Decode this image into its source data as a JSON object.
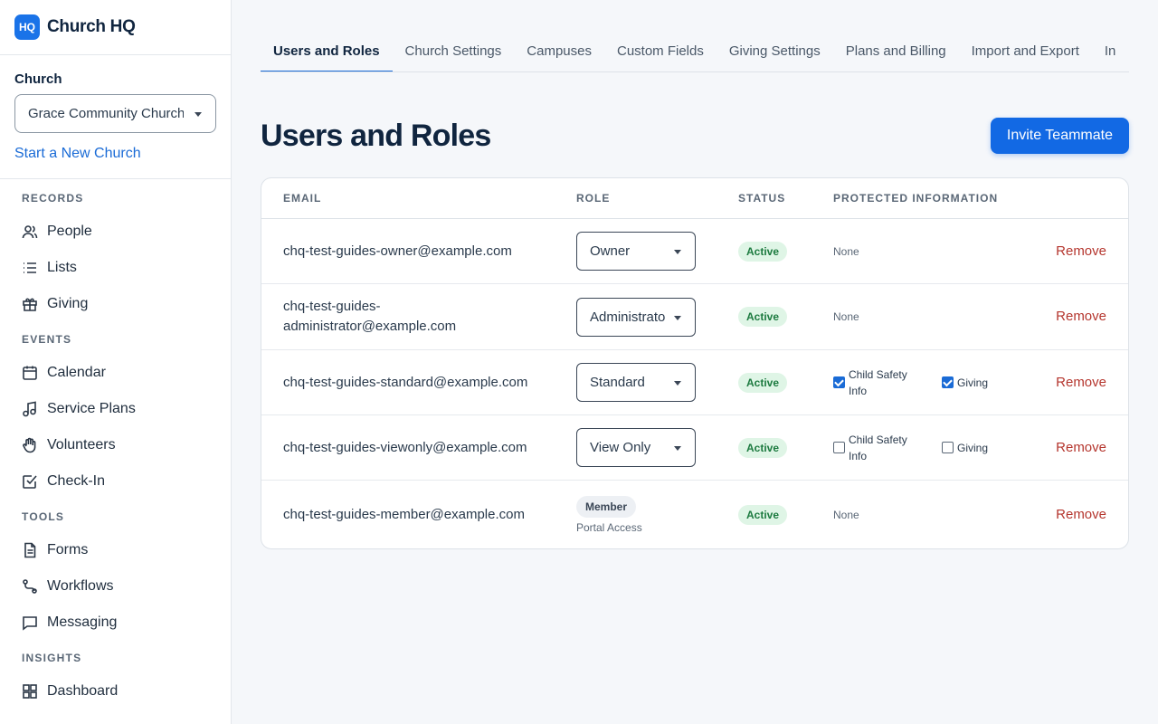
{
  "brand": {
    "logo": "HQ",
    "name": "Church HQ"
  },
  "church": {
    "label": "Church",
    "selected": "Grace Community Church",
    "new_link": "Start a New Church"
  },
  "nav": {
    "sections": [
      {
        "title": "RECORDS",
        "items": [
          {
            "label": "People",
            "icon": "people-icon"
          },
          {
            "label": "Lists",
            "icon": "list-icon"
          },
          {
            "label": "Giving",
            "icon": "gift-icon"
          }
        ]
      },
      {
        "title": "EVENTS",
        "items": [
          {
            "label": "Calendar",
            "icon": "calendar-icon"
          },
          {
            "label": "Service Plans",
            "icon": "music-note-icon"
          },
          {
            "label": "Volunteers",
            "icon": "hand-icon"
          },
          {
            "label": "Check-In",
            "icon": "checkbox-icon"
          }
        ]
      },
      {
        "title": "TOOLS",
        "items": [
          {
            "label": "Forms",
            "icon": "document-icon"
          },
          {
            "label": "Workflows",
            "icon": "workflow-icon"
          },
          {
            "label": "Messaging",
            "icon": "message-icon"
          }
        ]
      },
      {
        "title": "INSIGHTS",
        "items": [
          {
            "label": "Dashboard",
            "icon": "dashboard-icon"
          }
        ]
      }
    ]
  },
  "tabs": [
    "Users and Roles",
    "Church Settings",
    "Campuses",
    "Custom Fields",
    "Giving Settings",
    "Plans and Billing",
    "Import and Export",
    "In"
  ],
  "page": {
    "title": "Users and Roles",
    "invite_label": "Invite Teammate"
  },
  "table": {
    "headers": {
      "email": "EMAIL",
      "role": "ROLE",
      "status": "STATUS",
      "protected": "PROTECTED INFORMATION"
    },
    "rows": [
      {
        "email": "chq-test-guides-owner@example.com",
        "role": "Owner",
        "status": "Active",
        "protected": "None",
        "action": "Remove"
      },
      {
        "email_line1": "chq-test-guides-",
        "email_line2": "administrator@example.com",
        "role": "Administrato",
        "status": "Active",
        "protected": "None",
        "action": "Remove"
      },
      {
        "email": "chq-test-guides-standard@example.com",
        "role": "Standard",
        "status": "Active",
        "child_safety_line1": "Child Safety",
        "child_safety_line2": "Info",
        "giving": "Giving",
        "child_safety_checked": true,
        "giving_checked": true,
        "action": "Remove"
      },
      {
        "email": "chq-test-guides-viewonly@example.com",
        "role": "View Only",
        "status": "Active",
        "child_safety_line1": "Child Safety",
        "child_safety_line2": "Info",
        "giving": "Giving",
        "child_safety_checked": false,
        "giving_checked": false,
        "action": "Remove"
      },
      {
        "email": "chq-test-guides-member@example.com",
        "role_badge": "Member",
        "role_note": "Portal Access",
        "status": "Active",
        "protected": "None",
        "action": "Remove"
      }
    ]
  },
  "colors": {
    "accent": "#1269e4",
    "active_bg": "#dff5e6",
    "active_text": "#1c7a3f",
    "remove": "#b5362e"
  }
}
